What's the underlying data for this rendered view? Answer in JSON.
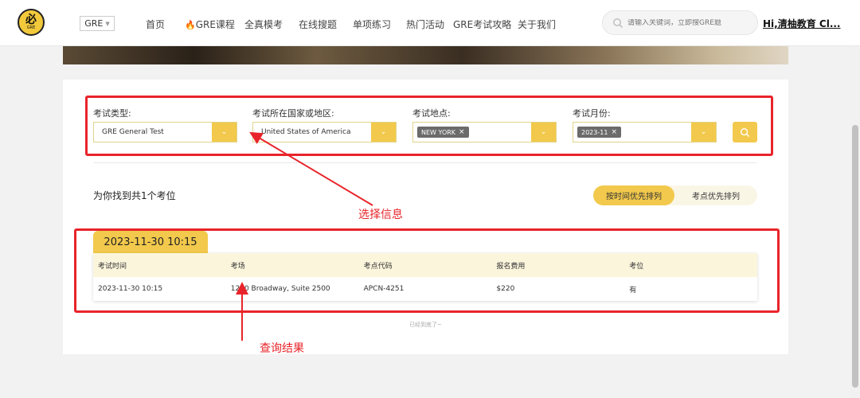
{
  "header": {
    "logo_main": "必",
    "logo_sub": "GRE",
    "exam_selector": "GRE",
    "nav": [
      {
        "label": "首页"
      },
      {
        "label": "GRE课程"
      },
      {
        "label": "全真模考"
      },
      {
        "label": "在线搜题"
      },
      {
        "label": "单项练习"
      },
      {
        "label": "热门活动"
      },
      {
        "label": "GRE考试攻略"
      },
      {
        "label": "关于我们"
      }
    ],
    "search_placeholder": "请输入关键词，立即搜GRE题",
    "user": "Hi,清柚教育 Cl..."
  },
  "filters": {
    "type_label": "考试类型:",
    "type_value": "GRE General Test",
    "country_label": "考试所在国家或地区:",
    "country_value": "United States of America",
    "location_label": "考试地点:",
    "location_tag": "NEW YORK",
    "month_label": "考试月份:",
    "month_tag": "2023-11",
    "colors": {
      "accent": "#f2c94c",
      "annotation": "#e8242a"
    }
  },
  "results": {
    "summary": "为你找到共1个考位",
    "sort_time": "按时间优先排列",
    "sort_place": "考点优先排列",
    "date_tab": "2023-11-30 10:15",
    "headers": [
      "考试时间",
      "考场",
      "考点代码",
      "报名费用",
      "考位"
    ],
    "rows": [
      [
        "2023-11-30 10:15",
        "1250 Broadway, Suite 2500",
        "APCN-4251",
        "$220",
        "有"
      ]
    ],
    "end_note": "已经到底了~"
  },
  "annotations": {
    "select_info": "选择信息",
    "query_result": "查询结果"
  }
}
